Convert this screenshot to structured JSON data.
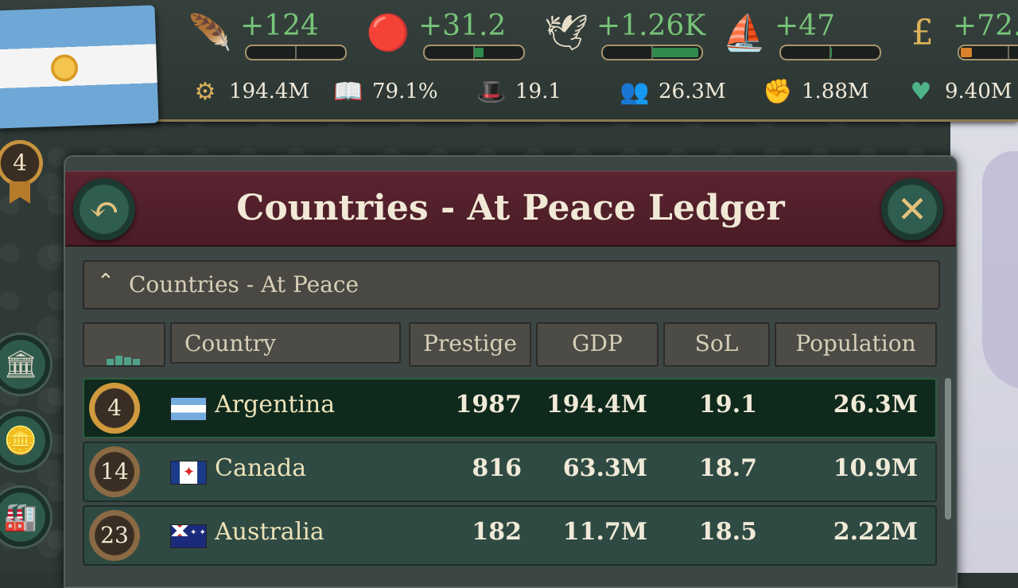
{
  "topbar": {
    "resources": [
      {
        "icon": "quill-icon",
        "value": "+124",
        "fill_pct": 0,
        "fill_color": "#2f8a4d"
      },
      {
        "icon": "wax-seal-icon",
        "value": "+31.2",
        "fill_pct": 10,
        "fill_color": "#2f8a4d"
      },
      {
        "icon": "dove-icon",
        "value": "+1.26K",
        "fill_pct": 48,
        "fill_color": "#2f8a4d"
      },
      {
        "icon": "ship-icon",
        "value": "+47",
        "fill_pct": 2,
        "fill_color": "#2f8a4d"
      },
      {
        "icon": "pound-icon",
        "value": "+72.",
        "fill_pct": 12,
        "fill_color": "#d9822b"
      }
    ],
    "stats": [
      {
        "icon": "gold-coin-icon",
        "value": "194.4M"
      },
      {
        "icon": "book-icon",
        "value": "79.1%"
      },
      {
        "icon": "hat-icon",
        "value": "19.1"
      },
      {
        "icon": "population-icon",
        "value": "26.3M"
      },
      {
        "icon": "fist-icon",
        "value": "1.88M"
      },
      {
        "icon": "heart-icon",
        "value": "9.40M"
      }
    ]
  },
  "sidebar": {
    "rank": "4"
  },
  "panel": {
    "title": "Countries - At Peace Ledger",
    "section_label": "Countries - At Peace",
    "columns": [
      "Country",
      "Prestige",
      "GDP",
      "SoL",
      "Population"
    ],
    "rows": [
      {
        "rank": "4",
        "country": "Argentina",
        "prestige": "1987",
        "gdp": "194.4M",
        "sol": "19.1",
        "population": "26.3M",
        "selected": true
      },
      {
        "rank": "14",
        "country": "Canada",
        "prestige": "816",
        "gdp": "63.3M",
        "sol": "18.7",
        "population": "10.9M",
        "selected": false
      },
      {
        "rank": "23",
        "country": "Australia",
        "prestige": "182",
        "gdp": "11.7M",
        "sol": "18.5",
        "population": "2.22M",
        "selected": false
      }
    ]
  },
  "colors": {
    "accent_gold": "#d09a3d",
    "header_maroon": "#5a2430",
    "positive_green": "#78c478"
  }
}
